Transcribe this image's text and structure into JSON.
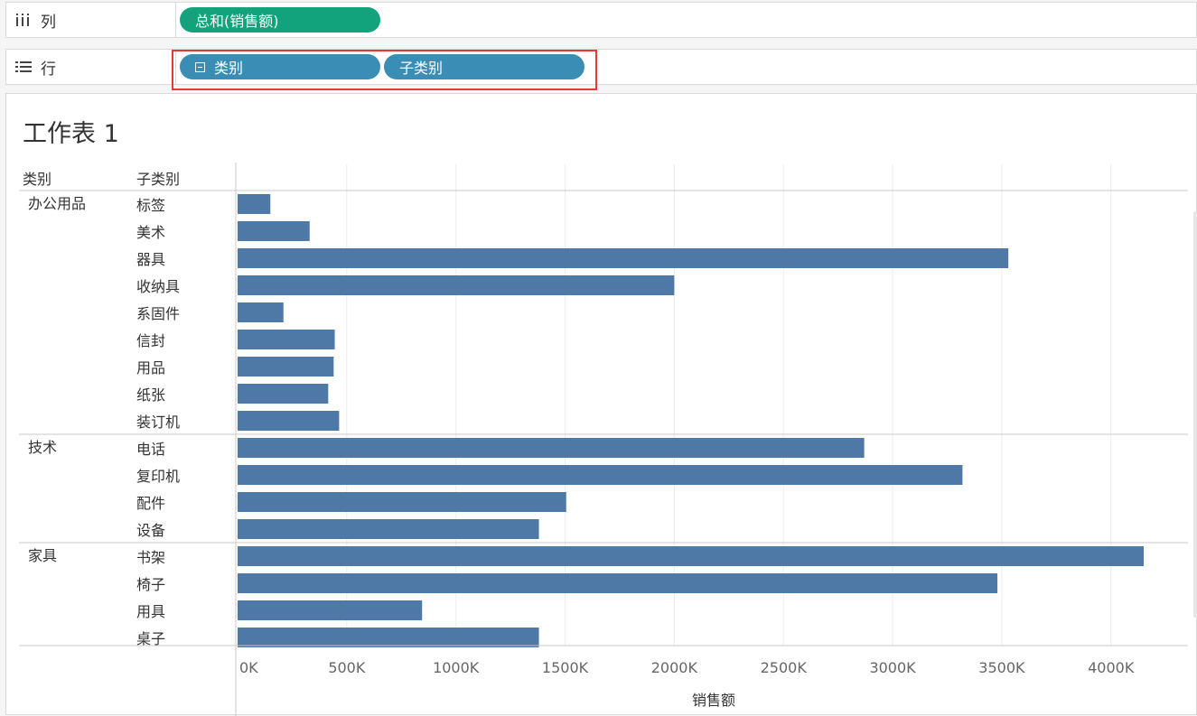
{
  "columns_shelf": {
    "label": "列",
    "icon": "columns-icon",
    "pill": "总和(销售额)"
  },
  "rows_shelf": {
    "label": "行",
    "icon": "rows-icon",
    "pills": [
      "类别",
      "子类别"
    ]
  },
  "sheet": {
    "title": "工作表 1"
  },
  "colors": {
    "bar": "#4e79a7",
    "pill_green": "#12a37d",
    "pill_blue": "#3a8eb6",
    "highlight": "#e53935"
  },
  "chart_data": {
    "type": "bar",
    "orientation": "horizontal",
    "row_headers": [
      "类别",
      "子类别"
    ],
    "xlabel": "销售额",
    "xlim": [
      0,
      4400000
    ],
    "x_ticks": [
      0,
      500000,
      1000000,
      1500000,
      2000000,
      2500000,
      3000000,
      3500000,
      4000000
    ],
    "x_tick_labels": [
      "0K",
      "500K",
      "1000K",
      "1500K",
      "2000K",
      "2500K",
      "3000K",
      "3500K",
      "4000K"
    ],
    "grid": true,
    "groups": [
      {
        "category": "办公用品",
        "items": [
          {
            "name": "标签",
            "value": 150000
          },
          {
            "name": "美术",
            "value": 330000
          },
          {
            "name": "器具",
            "value": 3530000
          },
          {
            "name": "收纳具",
            "value": 2000000
          },
          {
            "name": "系固件",
            "value": 210000
          },
          {
            "name": "信封",
            "value": 445000
          },
          {
            "name": "用品",
            "value": 440000
          },
          {
            "name": "纸张",
            "value": 415000
          },
          {
            "name": "装订机",
            "value": 465000
          }
        ]
      },
      {
        "category": "技术",
        "items": [
          {
            "name": "电话",
            "value": 2870000
          },
          {
            "name": "复印机",
            "value": 3320000
          },
          {
            "name": "配件",
            "value": 1505000
          },
          {
            "name": "设备",
            "value": 1380000
          }
        ]
      },
      {
        "category": "家具",
        "items": [
          {
            "name": "书架",
            "value": 4150000
          },
          {
            "name": "椅子",
            "value": 3480000
          },
          {
            "name": "用具",
            "value": 845000
          },
          {
            "name": "桌子",
            "value": 1380000
          }
        ]
      }
    ]
  }
}
